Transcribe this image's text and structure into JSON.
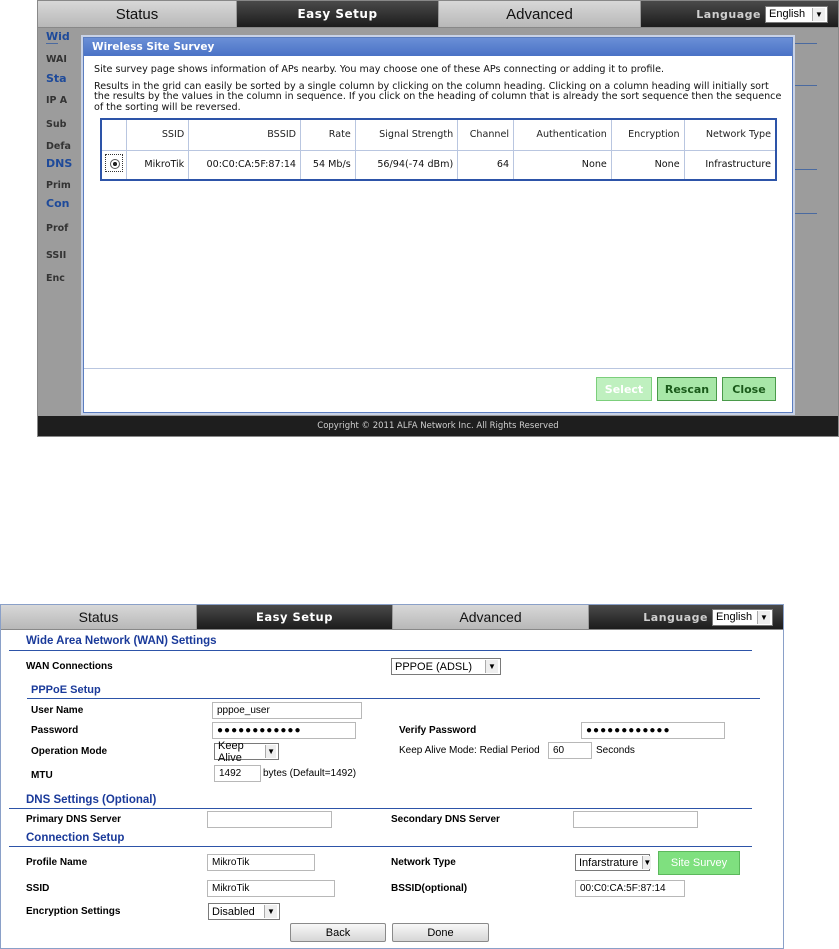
{
  "top": {
    "nav": {
      "tabs": [
        "Status",
        "Easy Setup",
        "Advanced"
      ],
      "language_label": "Language",
      "language_value": "English"
    },
    "background_fragments": [
      "Wid",
      "WAI",
      "Sta",
      "IP A",
      "Sub",
      "Defa",
      "DNS",
      "Prim",
      "Con",
      "Prof",
      "SSII",
      "Enc"
    ],
    "modal": {
      "title": "Wireless Site Survey",
      "text1": "Site survey page shows information of APs nearby. You may choose one of these APs connecting or adding it to profile.",
      "text2": "Results in the grid can easily be sorted by a single column by clicking on the column heading. Clicking on a column heading will initially sort the results by the values in the column in sequence. If you click on the heading of column that is already the sort sequence then the sequence of the sorting will be reversed.",
      "columns": [
        "",
        "SSID",
        "BSSID",
        "Rate",
        "Signal Strength",
        "Channel",
        "Authentication",
        "Encryption",
        "Network Type"
      ],
      "rows": [
        [
          "",
          "MikroTik",
          "00:C0:CA:5F:87:14",
          "54 Mb/s",
          "56/94(-74 dBm)",
          "64",
          "None",
          "None",
          "Infrastructure"
        ]
      ],
      "buttons": {
        "select": "Select",
        "rescan": "Rescan",
        "close": "Close"
      }
    },
    "footer": "Copyright © 2011 ALFA Network Inc. All Rights Reserved"
  },
  "bottom": {
    "nav": {
      "tabs": [
        "Status",
        "Easy Setup",
        "Advanced"
      ],
      "language_label": "Language",
      "language_value": "English"
    },
    "wan": {
      "title": "Wide Area Network (WAN) Settings",
      "connections_label": "WAN Connections",
      "connections_value": "PPPOE (ADSL)"
    },
    "pppoe": {
      "title": "PPPoE Setup",
      "user_label": "User Name",
      "user_value": "pppoe_user",
      "password_label": "Password",
      "password_value": "●●●●●●●●●●●●",
      "verify_label": "Verify Password",
      "verify_value": "●●●●●●●●●●●●",
      "opmode_label": "Operation Mode",
      "opmode_value": "Keep Alive",
      "redial_label": "Keep Alive Mode: Redial Period",
      "redial_value": "60",
      "redial_unit": "Seconds",
      "mtu_label": "MTU",
      "mtu_value": "1492",
      "mtu_hint": "bytes (Default=1492)"
    },
    "dns": {
      "title": "DNS Settings (Optional)",
      "primary_label": "Primary DNS Server",
      "primary_value": "",
      "secondary_label": "Secondary DNS Server",
      "secondary_value": ""
    },
    "conn": {
      "title": "Connection Setup",
      "profile_label": "Profile Name",
      "profile_value": "MikroTik",
      "nettype_label": "Network Type",
      "nettype_value": "Infarstrature",
      "survey_button": "Site Survey",
      "ssid_label": "SSID",
      "ssid_value": "MikroTik",
      "bssid_label": "BSSID(optional)",
      "bssid_value": "00:C0:CA:5F:87:14",
      "enc_label": "Encryption Settings",
      "enc_value": "Disabled"
    },
    "buttons": {
      "back": "Back",
      "done": "Done"
    }
  }
}
